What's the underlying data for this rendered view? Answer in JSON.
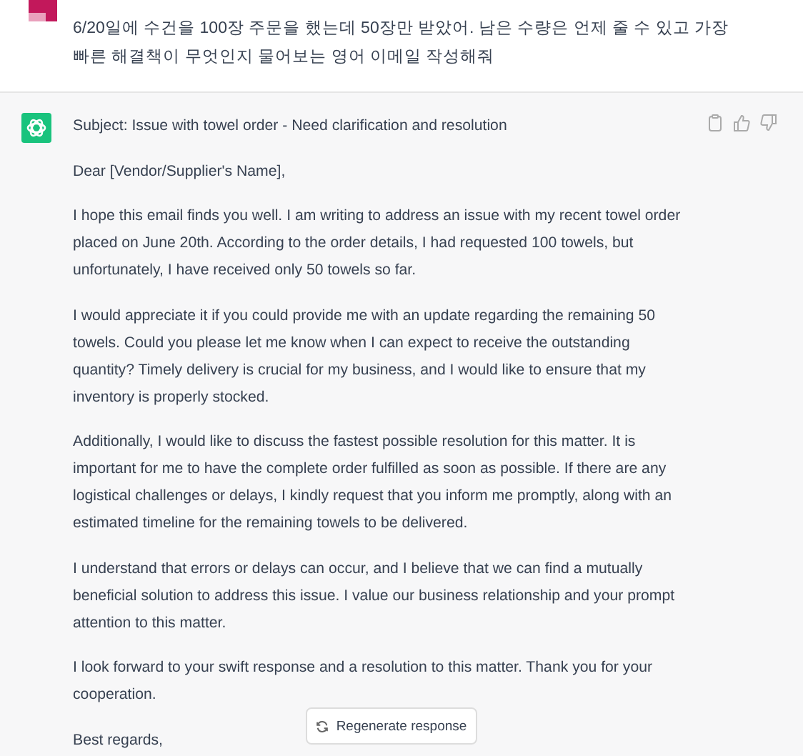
{
  "user_message": {
    "text": "6/20일에 수건을 100장 주문을 했는데 50장만 받았어. 남은 수량은 언제 줄 수 있고 가장 빠른 해결책이 무엇인지 물어보는 영어 이메일 작성해줘"
  },
  "assistant_message": {
    "paragraphs": [
      "Subject: Issue with towel order - Need clarification and resolution",
      "Dear [Vendor/Supplier's Name],",
      "I hope this email finds you well. I am writing to address an issue with my recent towel order placed on June 20th. According to the order details, I had requested 100 towels, but unfortunately, I have received only 50 towels so far.",
      "I would appreciate it if you could provide me with an update regarding the remaining 50 towels. Could you please let me know when I can expect to receive the outstanding quantity? Timely delivery is crucial for my business, and I would like to ensure that my inventory is properly stocked.",
      "Additionally, I would like to discuss the fastest possible resolution for this matter. It is important for me to have the complete order fulfilled as soon as possible. If there are any logistical challenges or delays, I kindly request that you inform me promptly, along with an estimated timeline for the remaining towels to be delivered.",
      "I understand that errors or delays can occur, and I believe that we can find a mutually beneficial solution to address this issue. I value our business relationship and your prompt attention to this matter.",
      "I look forward to your swift response and a resolution to this matter. Thank you for your cooperation.",
      "Best regards,"
    ]
  },
  "regenerate_button": {
    "label": "Regenerate response"
  }
}
